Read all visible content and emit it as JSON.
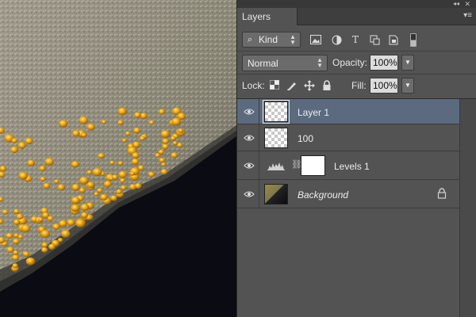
{
  "panel": {
    "tab_label": "Layers",
    "collapse_glyph": "◂◂",
    "close_glyph": "✕",
    "menu_glyph": "▾≡"
  },
  "filter": {
    "kind_label": "Kind",
    "icons": [
      "image-filter-icon",
      "adjustment-filter-icon",
      "type-filter-icon",
      "shape-filter-icon",
      "smart-object-filter-icon"
    ]
  },
  "blend": {
    "mode": "Normal",
    "opacity_label": "Opacity:",
    "opacity_value": "100%"
  },
  "lock": {
    "label": "Lock:",
    "fill_label": "Fill:",
    "fill_value": "100%",
    "icons": [
      "lock-transparency-icon",
      "lock-pixels-icon",
      "lock-position-icon",
      "lock-all-icon"
    ]
  },
  "layers": [
    {
      "name": "Layer 1",
      "selected": true,
      "type": "pixel"
    },
    {
      "name": "100",
      "selected": false,
      "type": "pixel"
    },
    {
      "name": "Levels 1",
      "selected": false,
      "type": "adjustment"
    },
    {
      "name": "Background",
      "selected": false,
      "type": "background",
      "locked": true
    }
  ],
  "colors": {
    "panel_bg": "#535353",
    "selected_row": "#5b6a7f",
    "droplet": "#e0a010"
  }
}
